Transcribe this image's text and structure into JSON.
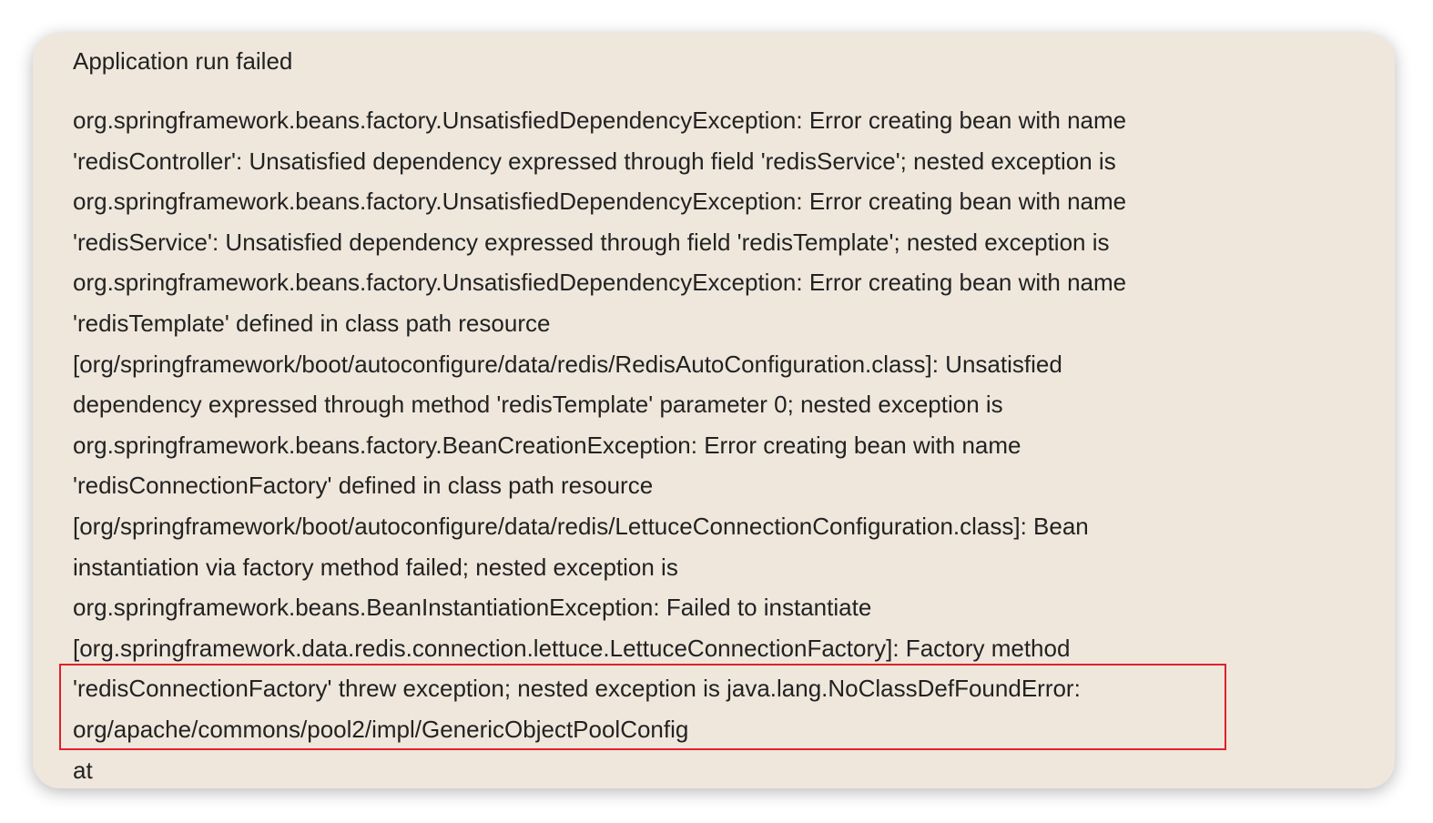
{
  "title": "Application run failed",
  "error_lines": [
    "org.springframework.beans.factory.UnsatisfiedDependencyException: Error creating bean with name",
    "'redisController': Unsatisfied dependency expressed through field 'redisService'; nested exception is",
    "org.springframework.beans.factory.UnsatisfiedDependencyException: Error creating bean with name",
    "'redisService': Unsatisfied dependency expressed through field 'redisTemplate'; nested exception is",
    "org.springframework.beans.factory.UnsatisfiedDependencyException: Error creating bean with name",
    "'redisTemplate' defined in class path resource",
    "[org/springframework/boot/autoconfigure/data/redis/RedisAutoConfiguration.class]: Unsatisfied",
    "dependency expressed through method 'redisTemplate' parameter 0; nested exception is",
    "org.springframework.beans.factory.BeanCreationException: Error creating bean with name",
    "'redisConnectionFactory' defined in class path resource",
    "[org/springframework/boot/autoconfigure/data/redis/LettuceConnectionConfiguration.class]: Bean",
    "instantiation via factory method failed; nested exception is",
    "org.springframework.beans.BeanInstantiationException: Failed to instantiate",
    "[org.springframework.data.redis.connection.lettuce.LettuceConnectionFactory]: Factory method",
    "'redisConnectionFactory' threw exception; nested exception is java.lang.NoClassDefFoundError:",
    "org/apache/commons/pool2/impl/GenericObjectPoolConfig",
    "at"
  ],
  "colors": {
    "card_background": "#efe7dc",
    "highlight_border": "#e0202a",
    "text": "#222222"
  }
}
